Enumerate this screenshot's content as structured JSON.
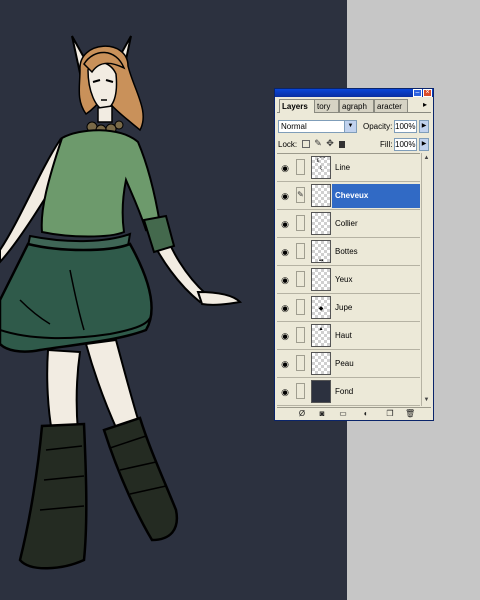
{
  "canvas": {
    "background": "#2c313f",
    "artwork": "elf-girl-illustration"
  },
  "palette": {
    "tabs": [
      {
        "label": "Layers",
        "active": true
      },
      {
        "label": "tory",
        "active": false
      },
      {
        "label": "agraph",
        "active": false
      },
      {
        "label": "aracter",
        "active": false
      }
    ],
    "tabs_menu_icon": "triangle-right-icon",
    "blend_mode": "Normal",
    "opacity_label": "Opacity:",
    "opacity_value": "100%",
    "lock_label": "Lock:",
    "fill_label": "Fill:",
    "fill_value": "100%",
    "selected_color": "#316ac5",
    "layers": [
      {
        "name": "Line",
        "visible": true,
        "selected": false
      },
      {
        "name": "Cheveux",
        "visible": true,
        "selected": true
      },
      {
        "name": "Collier",
        "visible": true,
        "selected": false
      },
      {
        "name": "Bottes",
        "visible": true,
        "selected": false
      },
      {
        "name": "Yeux",
        "visible": true,
        "selected": false
      },
      {
        "name": "Jupe",
        "visible": true,
        "selected": false
      },
      {
        "name": "Haut",
        "visible": true,
        "selected": false
      },
      {
        "name": "Peau",
        "visible": true,
        "selected": false
      },
      {
        "name": "Fond",
        "visible": true,
        "selected": false
      }
    ],
    "bottom_icons": [
      "layer-style-icon",
      "layer-mask-icon",
      "new-set-icon",
      "adjustment-layer-icon",
      "new-layer-icon",
      "trash-icon"
    ]
  }
}
